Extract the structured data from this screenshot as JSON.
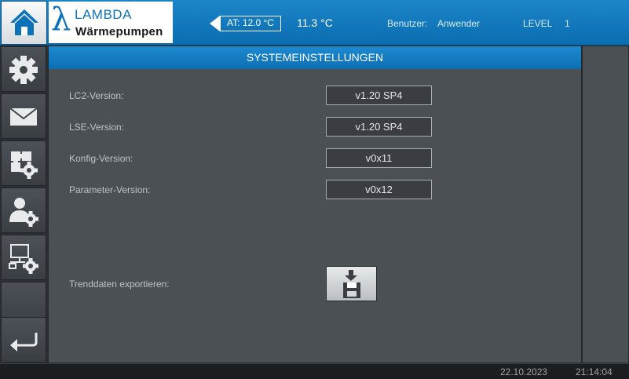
{
  "header": {
    "brand": "LAMBDA",
    "brand_sub": "Wärmepumpen",
    "outdoor_temp": "AT: 12.0 °C",
    "current_temp": "11.3 °C",
    "user_label": "Benutzer:",
    "user_value": "Anwender",
    "level_label": "LEVEL",
    "level_value": "1",
    "accent_color": "#0d72b7"
  },
  "sidebar": {
    "items": [
      {
        "icon": "gear-icon"
      },
      {
        "icon": "mail-icon"
      },
      {
        "icon": "puzzle-gear-icon"
      },
      {
        "icon": "user-gear-icon"
      },
      {
        "icon": "network-gear-icon"
      },
      {
        "icon": "back-arrow-icon"
      }
    ]
  },
  "main": {
    "title": "SYSTEMEINSTELLUNGEN",
    "rows": [
      {
        "label": "LC2-Version:",
        "value": "v1.20 SP4"
      },
      {
        "label": "LSE-Version:",
        "value": "v1.20 SP4"
      },
      {
        "label": "Konfig-Version:",
        "value": "v0x11"
      },
      {
        "label": "Parameter-Version:",
        "value": "v0x12"
      }
    ],
    "export_label": "Trenddaten exportieren:",
    "export_icon": "save-download-icon"
  },
  "footer": {
    "date": "22.10.2023",
    "time": "21:14:04"
  }
}
